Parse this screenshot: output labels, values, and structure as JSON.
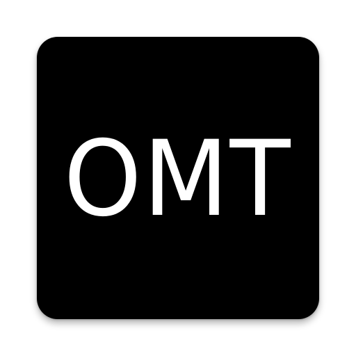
{
  "app_icon": {
    "label": "OMT",
    "background_color": "#000000",
    "text_color": "#ffffff"
  }
}
